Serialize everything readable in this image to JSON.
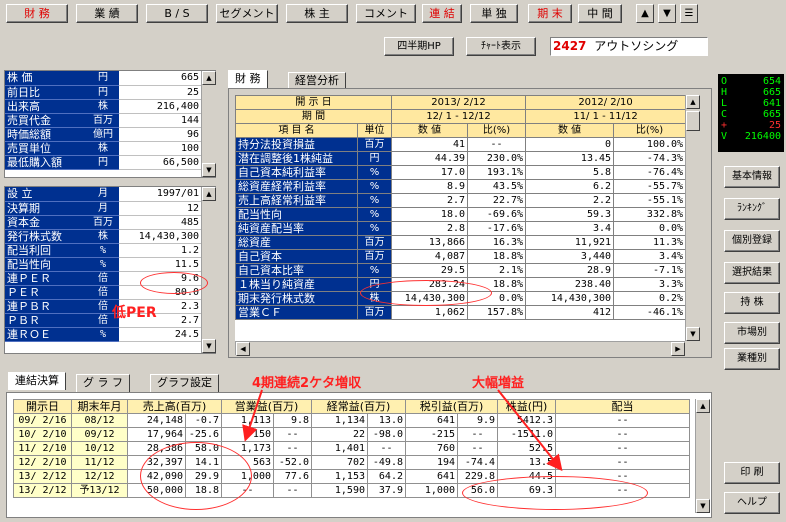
{
  "toolbar": {
    "buttons": [
      "財 務",
      "業 績",
      "B / S",
      "セグメント",
      "株 主",
      "コメント",
      "連 結",
      "単 独",
      "期 末",
      "中 間"
    ],
    "up": "▲",
    "down": "▼",
    "menu": "☰"
  },
  "subbar": {
    "quarterly": "四半期HP",
    "chart": "ﾁｬｰﾄ表示",
    "code": "2427",
    "company": "アウトソシング"
  },
  "quote": {
    "rows": [
      [
        "O",
        "654"
      ],
      [
        "H",
        "665"
      ],
      [
        "L",
        "641"
      ],
      [
        "C",
        "665"
      ],
      [
        "+",
        "25"
      ],
      [
        "V",
        "216400"
      ]
    ],
    "colors": {
      "label": "#00ff00",
      "value": "#00ff00",
      "plus": "#ff3030"
    }
  },
  "side_buttons": [
    "基本情報",
    "ﾗﾝｷﾝｸﾞ",
    "個別登録",
    "選択結果",
    "持 株",
    "市場別",
    "業種別",
    "印 刷",
    "ヘルプ"
  ],
  "price": [
    [
      "株 価",
      "円",
      "665"
    ],
    [
      "前日比",
      "円",
      "25"
    ],
    [
      "出来高",
      "株",
      "216,400"
    ],
    [
      "売買代金",
      "百万",
      "144"
    ],
    [
      "時価総額",
      "億円",
      "96"
    ],
    [
      "売買単位",
      "株",
      "100"
    ],
    [
      "最低購入額",
      "円",
      "66,500"
    ]
  ],
  "info": [
    [
      "設 立",
      "月",
      "1997/01"
    ],
    [
      "決算期",
      "月",
      "12"
    ],
    [
      "資本金",
      "百万",
      "485"
    ],
    [
      "発行株式数",
      "株",
      "14,430,300"
    ],
    [
      "配当利回",
      "%",
      "1.2"
    ],
    [
      "配当性向",
      "%",
      "11.5"
    ],
    [
      "連ＰＥＲ",
      "倍",
      "9.6"
    ],
    [
      "ＰＥＲ",
      "倍",
      "80.0"
    ],
    [
      "連ＰＢＲ",
      "倍",
      "2.3"
    ],
    [
      "ＰＢＲ",
      "倍",
      "2.7"
    ],
    [
      "連ＲＯＥ",
      "%",
      "24.5"
    ]
  ],
  "fin_tabs": [
    "財 務",
    "経営分析"
  ],
  "fin_header": {
    "disclosure": "開 示 日",
    "period": "期 間",
    "item": "項 目 名",
    "unit": "単位",
    "d1": "2013/ 2/12",
    "p1": "12/ 1 - 12/12",
    "d2": "2012/ 2/10",
    "p2": "11/ 1 - 11/12",
    "val": "数 値",
    "ratio": "比(%)"
  },
  "fin_rows": [
    [
      "持分法投資損益",
      "百万",
      "41",
      "--",
      "0",
      "100.0%"
    ],
    [
      "潜在調整後1株純益",
      "円",
      "44.39",
      "230.0%",
      "13.45",
      "-74.3%"
    ],
    [
      "自己資本純利益率",
      "%",
      "17.0",
      "193.1%",
      "5.8",
      "-76.4%"
    ],
    [
      "総資産経常利益率",
      "%",
      "8.9",
      "43.5%",
      "6.2",
      "-55.7%"
    ],
    [
      "売上高経常利益率",
      "%",
      "2.7",
      "22.7%",
      "2.2",
      "-55.1%"
    ],
    [
      "配当性向",
      "%",
      "18.0",
      "-69.6%",
      "59.3",
      "332.8%"
    ],
    [
      "純資産配当率",
      "%",
      "2.8",
      "-17.6%",
      "3.4",
      "0.0%"
    ],
    [
      "総資産",
      "百万",
      "13,866",
      "16.3%",
      "11,921",
      "11.3%"
    ],
    [
      "自己資本",
      "百万",
      "4,087",
      "18.8%",
      "3,440",
      "3.4%"
    ],
    [
      "自己資本比率",
      "%",
      "29.5",
      "2.1%",
      "28.9",
      "-7.1%"
    ],
    [
      "１株当り純資産",
      "円",
      "283.24",
      "18.8%",
      "238.40",
      "3.3%"
    ],
    [
      "期末発行株式数",
      "株",
      "14,430,300",
      "0.0%",
      "14,430,300",
      "0.2%"
    ],
    [
      "営業ＣＦ",
      "百万",
      "1,062",
      "157.8%",
      "412",
      "-46.1%"
    ]
  ],
  "bottom_tabs": [
    "連結決算",
    "グ ラ フ",
    "グラフ設定"
  ],
  "bottom_header": [
    "開示日",
    "期末年月",
    "売上高(百万)",
    "営業益(百万)",
    "経常益(百万)",
    "税引益(百万)",
    "株益(円)",
    "配当"
  ],
  "bottom_rows": [
    [
      "09/ 2/16",
      "08/12",
      "24,148",
      "-0.7",
      "1,113",
      "9.8",
      "1,134",
      "13.0",
      "641",
      "9.9",
      "5412.3",
      "--"
    ],
    [
      "10/ 2/10",
      "09/12",
      "17,964",
      "-25.6",
      "-150",
      "--",
      "22",
      "-98.0",
      "-215",
      "--",
      "-1511.0",
      "--"
    ],
    [
      "11/ 2/10",
      "10/12",
      "28,386",
      "58.0",
      "1,173",
      "--",
      "1,401",
      "--",
      "760",
      "--",
      "52.5",
      "--"
    ],
    [
      "12/ 2/10",
      "11/12",
      "32,397",
      "14.1",
      "563",
      "-52.0",
      "702",
      "-49.8",
      "194",
      "-74.4",
      "13.5",
      "--"
    ],
    [
      "13/ 2/12",
      "12/12",
      "42,090",
      "29.9",
      "1,000",
      "77.6",
      "1,153",
      "64.2",
      "641",
      "229.8",
      "44.5",
      "--"
    ],
    [
      "13/ 2/12",
      "予13/12",
      "50,000",
      "18.8",
      "--",
      "--",
      "1,590",
      "37.9",
      "1,000",
      "56.0",
      "69.3",
      "--"
    ]
  ],
  "annotations": {
    "low_per": "低PER",
    "growth": "4期連続2ケタ増収",
    "profit": "大幅増益"
  }
}
